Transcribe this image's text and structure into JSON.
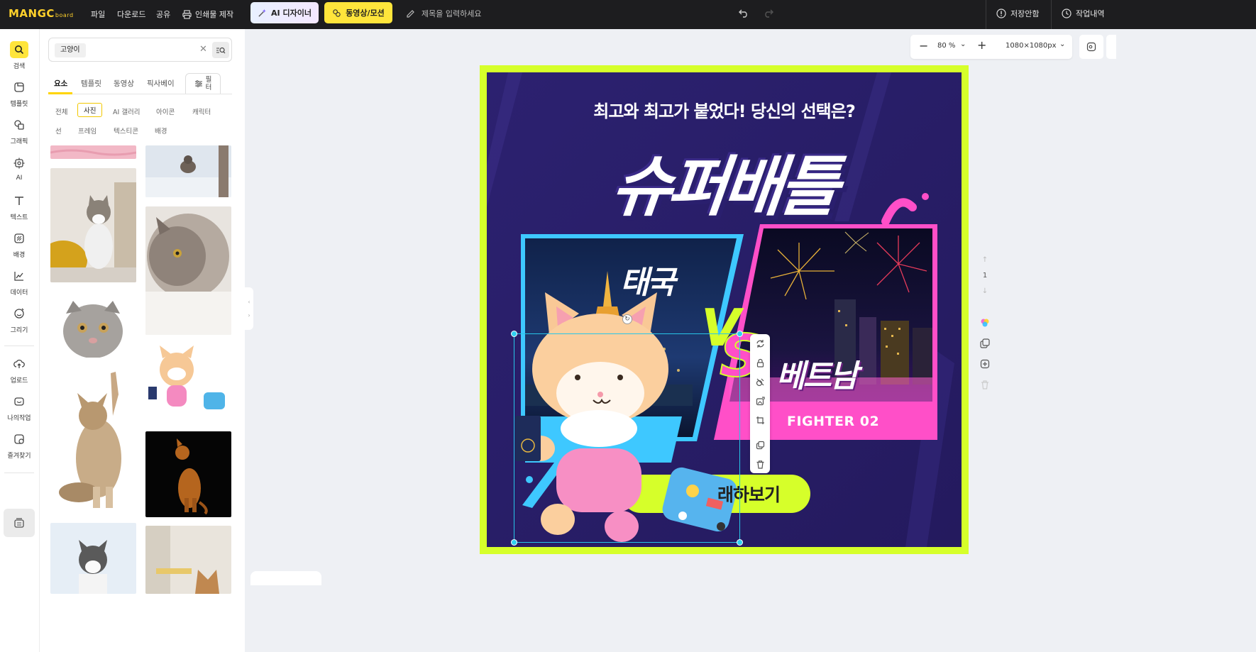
{
  "app": {
    "logo": "MANGC",
    "logo_sub": "board"
  },
  "topbar": {
    "menu": [
      "파일",
      "다운로드",
      "공유",
      "인쇄물 제작"
    ],
    "ai_button": "AI 디자이너",
    "video_button": "동영상/모션",
    "title_placeholder": "제목을 입력하세요",
    "unsaved": "저장안함",
    "history": "작업내역"
  },
  "rail": {
    "items": [
      "검색",
      "템플릿",
      "그래픽",
      "AI",
      "텍스트",
      "배경",
      "데이터",
      "그리기",
      "업로드",
      "나의작업",
      "즐겨찾기"
    ]
  },
  "search": {
    "query": "고양이",
    "tabs": [
      "요소",
      "템플릿",
      "동영상",
      "픽사베이"
    ],
    "filter_label_1": "필",
    "filter_label_2": "터",
    "subcategories_row1": [
      "전체",
      "사진",
      "AI 갤러리",
      "아이콘",
      "캐릭터"
    ],
    "subcategories_row2": [
      "선",
      "프레임",
      "텍스티콘",
      "배경"
    ]
  },
  "zoom": {
    "level": "80 %",
    "size": "1080×1080px"
  },
  "pager": {
    "page": "1"
  },
  "poster": {
    "headline": "최고와 최고가 붙었다! 당신의 선택은?",
    "title": "슈퍼배틀",
    "fighter_a": "태국",
    "fighter_b": "베트남",
    "vs": "VS",
    "fighter_b_tag": "FIGHTER 02",
    "cta": "래하보기",
    "colors": {
      "bg": "#2a1f70",
      "lime": "#d6ff2a",
      "pink": "#ff4fc8",
      "cyan": "#3ec8ff"
    }
  }
}
